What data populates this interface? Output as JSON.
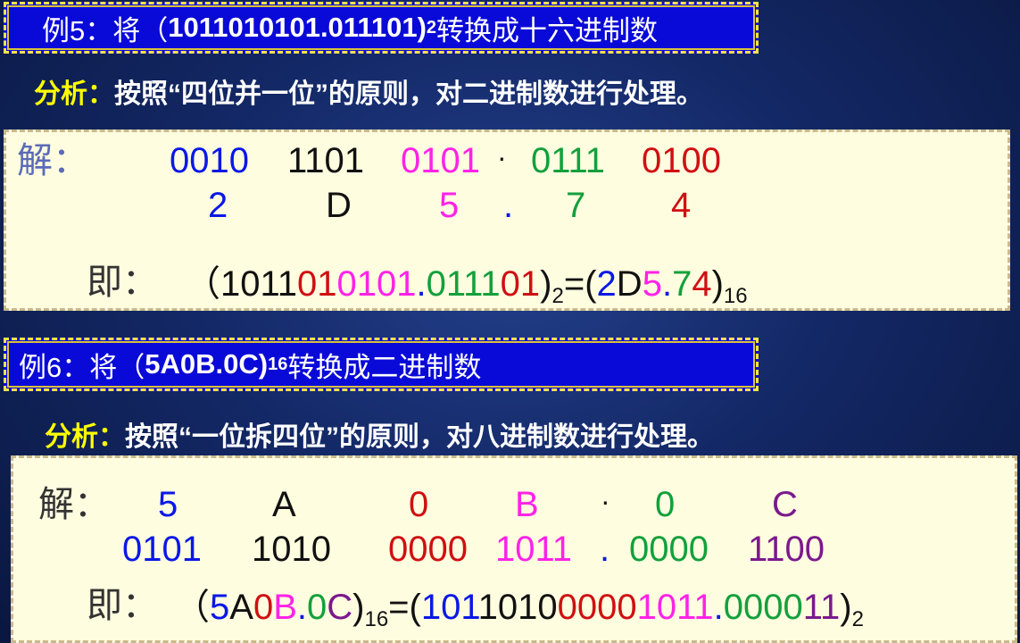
{
  "ex5": {
    "title_prefix": "例5：将（",
    "title_num": "1011010101.011101)",
    "title_sub": "2",
    "title_suffix": "转换成十六进制数",
    "analysis_label": "分析：",
    "analysis_text": "按照“四位并一位”的原则，对二进制数进行处理。",
    "solution_label": "解：",
    "groups": [
      "0010",
      "1101",
      "0101",
      "0111",
      "0100"
    ],
    "dot": "·",
    "digits": [
      "2",
      "D",
      "5",
      "7",
      "4"
    ],
    "digit_dot": ".",
    "result_label": "即：",
    "result": {
      "open": "（",
      "bin_k": "1011",
      "bin_r": "01",
      "bin_m": "0101",
      "bin_dot": ".",
      "bin_g": "0111",
      "bin_r2": "01",
      "close": ")",
      "base_in": "2",
      "eq": "=(",
      "hex_b": "2",
      "hex_k": "D",
      "hex_m": "5",
      "hex_dot": ".",
      "hex_g": "7",
      "hex_r": "4",
      "close2": ")",
      "base_out": "16"
    }
  },
  "ex6": {
    "title_prefix": "例6：将（",
    "title_num": "5A0B.0C)",
    "title_sub": "16",
    "title_suffix": "转换成二进制数",
    "analysis_label": "分析：",
    "analysis_text": "按照“一位拆四位”的原则，对八进制数进行处理。",
    "solution_label": "解：",
    "digits": [
      "5",
      "A",
      "0",
      "B",
      "0",
      "C"
    ],
    "dot": "·",
    "groups": [
      "0101",
      "1010",
      "0000",
      "1011",
      "0000",
      "1100"
    ],
    "group_dot": ".",
    "result_label": "即：",
    "result": {
      "open": "（",
      "h1": "5",
      "h2": "A",
      "h3": "0",
      "h4": "B",
      "hdot": ".",
      "h5": "0",
      "h6": "C",
      "close": ")",
      "base_in": "16",
      "eq": "=(",
      "b1": "101",
      "b2": "1010",
      "b3": "0000",
      "b4": "1011",
      "bdot": ".",
      "b5": "0000",
      "b6": "11",
      "close2": ")",
      "base_out": "2"
    }
  },
  "colors": {
    "title_bg": "#0a0ad8",
    "title_border": "#ffe34a",
    "analysis_highlight": "#ffff00",
    "box_bg": "#fffde0",
    "blue": "#0a18e6",
    "black": "#111111",
    "magenta": "#ff22e8",
    "green": "#13a03c",
    "red": "#d00f12",
    "purple": "#7a1a8c"
  }
}
